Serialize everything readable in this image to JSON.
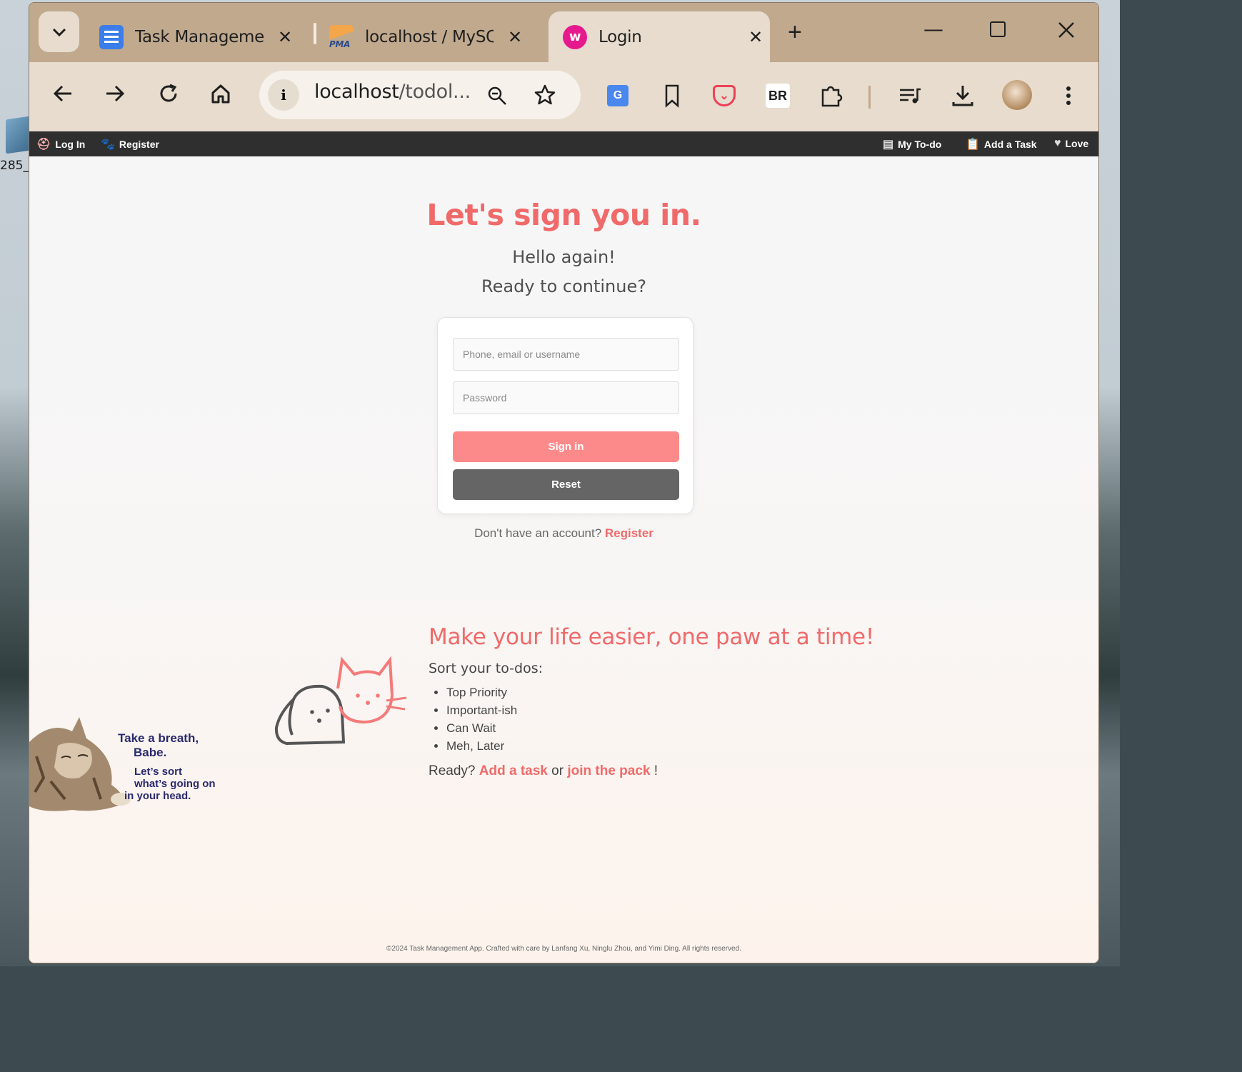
{
  "desktop": {
    "icon_label": "285_"
  },
  "browser": {
    "tabs": [
      {
        "title": "Task Management"
      },
      {
        "title": "localhost / MySQL"
      },
      {
        "title": "Login"
      }
    ],
    "url_host": "localhost",
    "url_rest": "/todol...",
    "close_glyph": "✕",
    "new_tab_glyph": "+"
  },
  "bookmarks": {
    "left": [
      {
        "label": "Log In",
        "icon": "login-icon"
      },
      {
        "label": "Register",
        "icon": "paw-icon"
      }
    ],
    "right": [
      {
        "label": "My To-do",
        "icon": "list-icon"
      },
      {
        "label": "Add a Task",
        "icon": "clipboard-icon"
      },
      {
        "label": "Love",
        "icon": "heart-icon"
      }
    ]
  },
  "login": {
    "title": "Let's sign you in.",
    "subtitle1": "Hello again!",
    "subtitle2": "Ready to continue?",
    "username_placeholder": "Phone, email or username",
    "password_placeholder": "Password",
    "signin_label": "Sign in",
    "reset_label": "Reset",
    "no_account_text": "Don't have an account?",
    "register_link": "Register"
  },
  "promo": {
    "title": "Make your life easier, one paw at a time!",
    "sort_title": "Sort your to-dos:",
    "items": [
      "Top Priority",
      "Important-ish",
      "Can Wait",
      "Meh, Later"
    ],
    "ready_text": "Ready?",
    "add_task_link": "Add a task",
    "or_text": "or",
    "join_link": "join the pack",
    "end_text": "!"
  },
  "kitty": {
    "line1": "Take a breath,",
    "line2": "Babe.",
    "line3": "Let’s sort",
    "line4": "what’s going on",
    "line5": "in your head."
  },
  "footer": {
    "text": "©2024 Task Management App. Crafted with care by Lanfang Xu, Ninglu Zhou, and Yimi Ding. All rights reserved."
  },
  "colors": {
    "accent": "#f06a6a",
    "signin_bg": "#fd8a8a",
    "reset_bg": "#656565",
    "tabbar": "#c1a98e",
    "toolbar": "#e7dccd",
    "bookmarkbar": "#2f2f2f"
  }
}
